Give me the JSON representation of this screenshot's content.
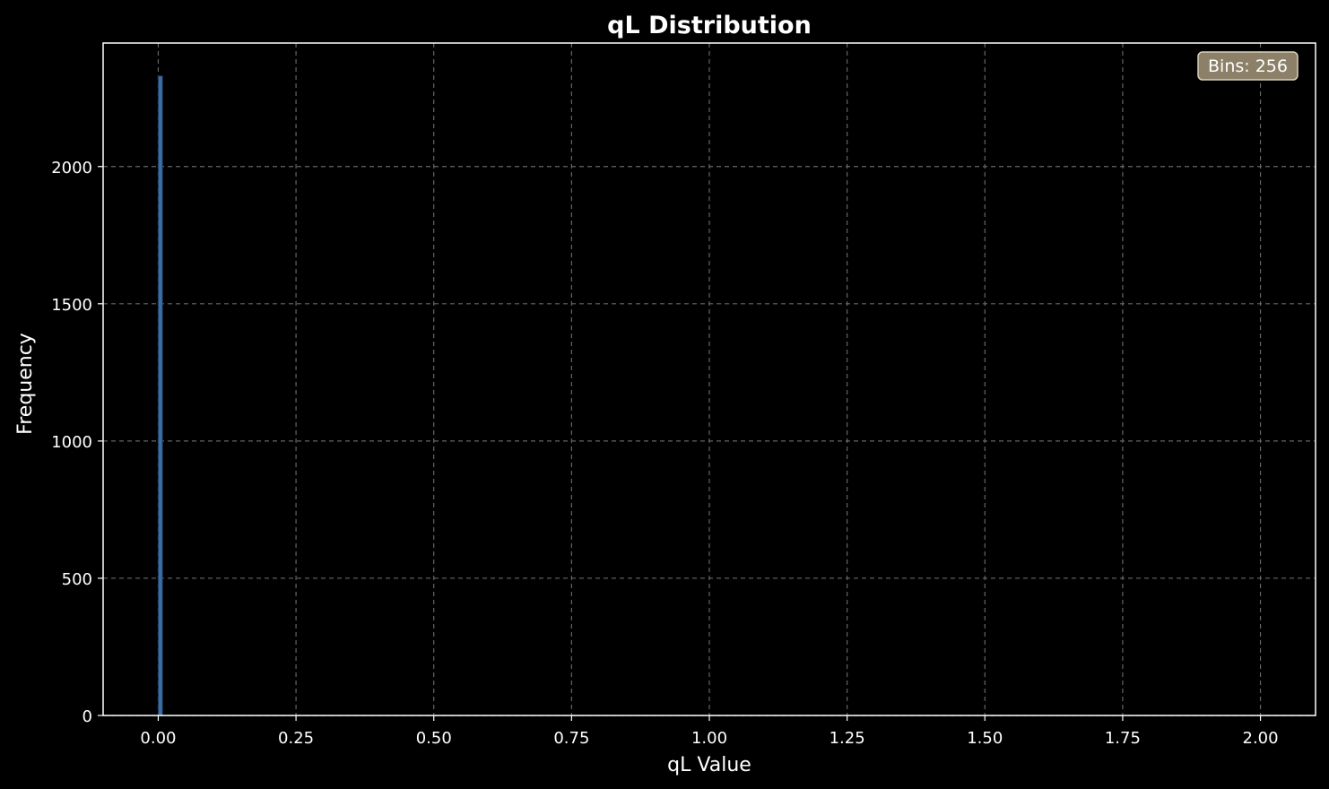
{
  "colors": {
    "background": "#000000",
    "bar": "#3a6ea5",
    "bar_edge": "#1e3a5a",
    "axes": "#ffffff",
    "grid": "#666666",
    "badge_fill": "#8c8068",
    "badge_edge": "#d8d0bc"
  },
  "chart_data": {
    "type": "bar",
    "title": "qL Distribution",
    "xlabel": "qL Value",
    "ylabel": "Frequency",
    "xlim": [
      -0.1,
      2.1
    ],
    "ylim": [
      0,
      2450
    ],
    "xticks": [
      "0.00",
      "0.25",
      "0.50",
      "0.75",
      "1.00",
      "1.25",
      "1.50",
      "1.75",
      "2.00"
    ],
    "yticks": [
      "0",
      "500",
      "1000",
      "1500",
      "2000"
    ],
    "grid": true,
    "annotation": "Bins: 256",
    "annotation_position": "top-right",
    "bin_range": [
      0,
      2
    ],
    "bin_count": 256,
    "values": [
      2330,
      0,
      0,
      0,
      0,
      0,
      0,
      0,
      0,
      0,
      0,
      0,
      0,
      0,
      0,
      0,
      0,
      0,
      0,
      0,
      0,
      0,
      0,
      0,
      0,
      0,
      0,
      0,
      0,
      0,
      0,
      0,
      0,
      0,
      0,
      0,
      0,
      0,
      0,
      0,
      0,
      0,
      0,
      0,
      0,
      0,
      0,
      0,
      0,
      0,
      0,
      0,
      0,
      0,
      0,
      0,
      0,
      0,
      0,
      0,
      0,
      0,
      0,
      0,
      0,
      0,
      0,
      0,
      0,
      0,
      0,
      0,
      0,
      0,
      0,
      0,
      0,
      0,
      0,
      0,
      0,
      0,
      0,
      0,
      0,
      0,
      0,
      0,
      0,
      0,
      0,
      0,
      0,
      0,
      0,
      0,
      0,
      0,
      0,
      0,
      0,
      0,
      0,
      0,
      0,
      0,
      0,
      0,
      0,
      0,
      0,
      0,
      0,
      0,
      0,
      0,
      0,
      0,
      0,
      0,
      0,
      0,
      0,
      0,
      0,
      0,
      0,
      0,
      0,
      0,
      0,
      0,
      0,
      0,
      0,
      0,
      0,
      0,
      0,
      0,
      0,
      0,
      0,
      0,
      0,
      0,
      0,
      0,
      0,
      0,
      0,
      0,
      0,
      0,
      0,
      0,
      0,
      0,
      0,
      0,
      0,
      0,
      0,
      0,
      0,
      0,
      0,
      0,
      0,
      0,
      0,
      0,
      0,
      0,
      0,
      0,
      0,
      0,
      0,
      0,
      0,
      0,
      0,
      0,
      0,
      0,
      0,
      0,
      0,
      0,
      0,
      0,
      0,
      0,
      0,
      0,
      0,
      0,
      0,
      0,
      0,
      0,
      0,
      0,
      0,
      0,
      0,
      0,
      0,
      0,
      0,
      0,
      0,
      0,
      0,
      0,
      0,
      0,
      0,
      0,
      0,
      0,
      0,
      0,
      0,
      0,
      0,
      0,
      0,
      0,
      0,
      0,
      0,
      0,
      0,
      0,
      0,
      0,
      0,
      0,
      0,
      0,
      0,
      0,
      0,
      0,
      0,
      0,
      0,
      0,
      0,
      0,
      0,
      0,
      0,
      0,
      0,
      0,
      0
    ]
  }
}
